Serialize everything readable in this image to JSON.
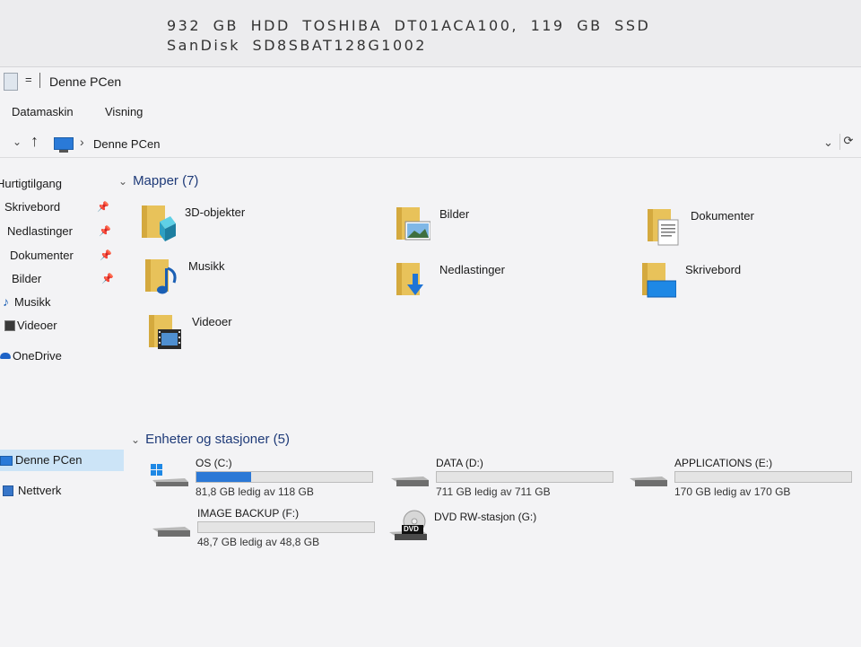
{
  "desktop": {
    "spec_text": "932 GB HDD TOSHIBA DT01ACA100, 119 GB SSD SanDisk SD8SBAT128G1002"
  },
  "window": {
    "title": "Denne PCen",
    "qa_arrow": "=",
    "ribbon_tabs": [
      "Datamaskin",
      "Visning"
    ]
  },
  "address": {
    "location": "Denne PCen",
    "chevron": "›",
    "dropdown": "⌄",
    "refresh": "⟳",
    "up": "↑",
    "down": "⌄"
  },
  "nav": {
    "pin_glyph": "📌",
    "items": [
      {
        "label": "Hurtigtilgang",
        "pinned": false
      },
      {
        "label": "Skrivebord",
        "pinned": true
      },
      {
        "label": "Nedlastinger",
        "pinned": true
      },
      {
        "label": "Dokumenter",
        "pinned": true
      },
      {
        "label": "Bilder",
        "pinned": true
      },
      {
        "label": "Musikk",
        "pinned": false
      },
      {
        "label": "Videoer",
        "pinned": false
      },
      {
        "label": "OneDrive",
        "pinned": false
      },
      {
        "label": "Denne PCen",
        "pinned": false,
        "selected": true
      },
      {
        "label": "Nettverk",
        "pinned": false
      }
    ]
  },
  "folders_group": {
    "chevron": "⌄",
    "title": "Mapper (7)",
    "items": [
      {
        "name": "3D-objekter",
        "icon": "3d-objects-icon"
      },
      {
        "name": "Bilder",
        "icon": "pictures-icon"
      },
      {
        "name": "Dokumenter",
        "icon": "documents-icon"
      },
      {
        "name": "Musikk",
        "icon": "music-icon"
      },
      {
        "name": "Nedlastinger",
        "icon": "downloads-icon"
      },
      {
        "name": "Skrivebord",
        "icon": "desktop-icon"
      },
      {
        "name": "Videoer",
        "icon": "videos-icon"
      }
    ]
  },
  "drives_group": {
    "chevron": "⌄",
    "title": "Enheter og stasjoner (5)",
    "items": [
      {
        "name": "OS (C:)",
        "free": "81,8 GB ledig av 118 GB",
        "used_fraction": 0.31,
        "icon": "windows-drive-icon"
      },
      {
        "name": "DATA (D:)",
        "free": "711 GB ledig av 711 GB",
        "used_fraction": 0.0,
        "icon": "hard-drive-icon"
      },
      {
        "name": "APPLICATIONS (E:)",
        "free": "170 GB ledig av 170 GB",
        "used_fraction": 0.0,
        "icon": "hard-drive-icon"
      },
      {
        "name": "IMAGE BACKUP (F:)",
        "free": "48,7 GB ledig av 48,8 GB",
        "used_fraction": 0.0,
        "icon": "hard-drive-icon"
      },
      {
        "name": "DVD RW-stasjon (G:)",
        "dvd_label": "DVD",
        "icon": "dvd-drive-icon"
      }
    ]
  },
  "colors": {
    "accent": "#2b78d6",
    "folder": "#e8c25a",
    "selection": "#cce4f7",
    "header": "#1e3a78"
  }
}
